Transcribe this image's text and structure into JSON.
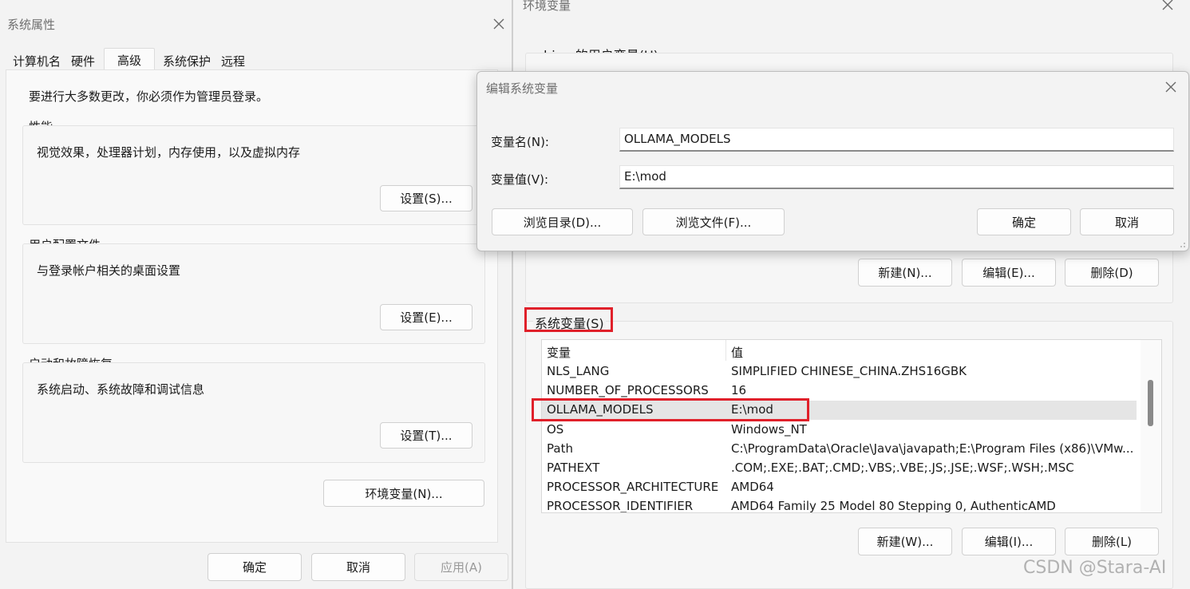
{
  "system_properties": {
    "title": "系统属性",
    "tabs": [
      "计算机名",
      "硬件",
      "高级",
      "系统保护",
      "远程"
    ],
    "active_tab": "高级",
    "admin_note": "要进行大多数更改，你必须作为管理员登录。",
    "performance": {
      "title": "性能",
      "desc": "视觉效果，处理器计划，内存使用，以及虚拟内存",
      "button": "设置(S)..."
    },
    "user_profiles": {
      "title": "用户配置文件",
      "desc": "与登录帐户相关的桌面设置",
      "button": "设置(E)..."
    },
    "startup_recovery": {
      "title": "启动和故障恢复",
      "desc": "系统启动、系统故障和调试信息",
      "button": "设置(T)..."
    },
    "env_button": "环境变量(N)...",
    "ok": "确定",
    "cancel": "取消",
    "apply": "应用(A)"
  },
  "env_vars": {
    "title": "环境变量",
    "user_section": "wbigo 的用户变量(U)",
    "user_buttons": {
      "new": "新建(N)...",
      "edit": "编辑(E)...",
      "delete": "删除(D)"
    },
    "system_section": "系统变量(S)",
    "columns": {
      "name": "变量",
      "value": "值"
    },
    "rows": [
      {
        "name": "NLS_LANG",
        "value": "SIMPLIFIED CHINESE_CHINA.ZHS16GBK"
      },
      {
        "name": "NUMBER_OF_PROCESSORS",
        "value": "16"
      },
      {
        "name": "OLLAMA_MODELS",
        "value": "E:\\mod"
      },
      {
        "name": "OS",
        "value": "Windows_NT"
      },
      {
        "name": "Path",
        "value": "C:\\ProgramData\\Oracle\\Java\\javapath;E:\\Program Files (x86)\\VMw..."
      },
      {
        "name": "PATHEXT",
        "value": ".COM;.EXE;.BAT;.CMD;.VBS;.VBE;.JS;.JSE;.WSF;.WSH;.MSC"
      },
      {
        "name": "PROCESSOR_ARCHITECTURE",
        "value": "AMD64"
      },
      {
        "name": "PROCESSOR_IDENTIFIER",
        "value": "AMD64 Family 25 Model 80 Stepping 0, AuthenticAMD"
      }
    ],
    "system_buttons": {
      "new": "新建(W)...",
      "edit": "编辑(I)...",
      "delete": "删除(L)"
    }
  },
  "edit_dialog": {
    "title": "编辑系统变量",
    "name_label": "变量名(N):",
    "name_value": "OLLAMA_MODELS",
    "value_label": "变量值(V):",
    "value_value": "E:\\mod",
    "browse_dir": "浏览目录(D)...",
    "browse_file": "浏览文件(F)...",
    "ok": "确定",
    "cancel": "取消"
  },
  "watermark": "CSDN @Stara-AI",
  "colors": {
    "highlight_box": "#e0202a",
    "selected_row": "#e5e5e5"
  }
}
